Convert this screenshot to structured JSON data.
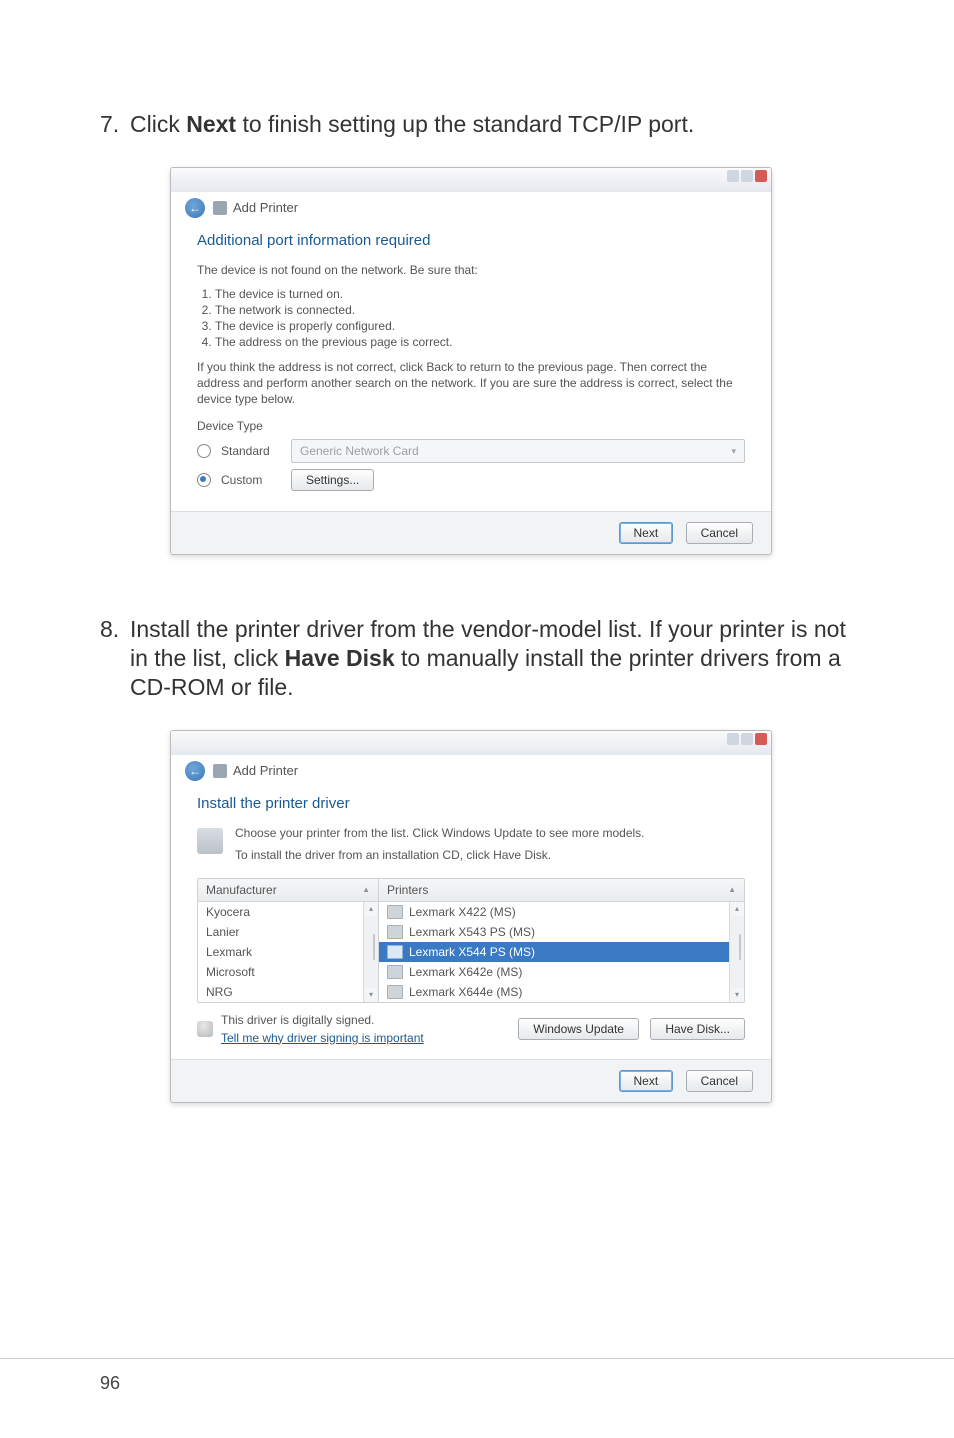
{
  "page_number": "96",
  "step7": {
    "num": "7.",
    "pre": "Click ",
    "bold": "Next",
    "post": " to finish setting up the standard TCP/IP port."
  },
  "step8": {
    "num": "8.",
    "pre": "Install the printer driver from the vendor-model list. If your printer is not in the list, click ",
    "bold": "Have Disk",
    "post": " to manually install the printer drivers from a CD-ROM or file."
  },
  "dlg1": {
    "title": "Add Printer",
    "heading": "Additional port information required",
    "subtitle": "The device is not found on the network.  Be sure that:",
    "items": [
      "The device is turned on.",
      "The network is connected.",
      "The device is properly configured.",
      "The address on the previous page is correct."
    ],
    "note": "If you think the address is not correct, click Back to return to the previous page. Then correct the address and perform another search on the network. If you are sure the address is correct, select the device type below.",
    "device_type_label": "Device Type",
    "standard_label": "Standard",
    "standard_value": "Generic Network Card",
    "custom_label": "Custom",
    "settings_btn": "Settings...",
    "next_btn": "Next",
    "cancel_btn": "Cancel"
  },
  "dlg2": {
    "title": "Add Printer",
    "heading": "Install the printer driver",
    "line1": "Choose your printer from the list. Click Windows Update to see more models.",
    "line2": "To install the driver from an installation CD, click Have Disk.",
    "mfr_header": "Manufacturer",
    "prn_header": "Printers",
    "manufacturers": [
      "Kyocera",
      "Lanier",
      "Lexmark",
      "Microsoft",
      "NRG"
    ],
    "printers": [
      "Lexmark X422 (MS)",
      "Lexmark X543 PS (MS)",
      "Lexmark X544 PS (MS)",
      "Lexmark X642e (MS)",
      "Lexmark X644e (MS)"
    ],
    "selected_printer_index": 2,
    "signed_text": "This driver is digitally signed.",
    "signing_link": "Tell me why driver signing is important",
    "win_update_btn": "Windows Update",
    "have_disk_btn": "Have Disk...",
    "next_btn": "Next",
    "cancel_btn": "Cancel"
  },
  "chart_data": null
}
